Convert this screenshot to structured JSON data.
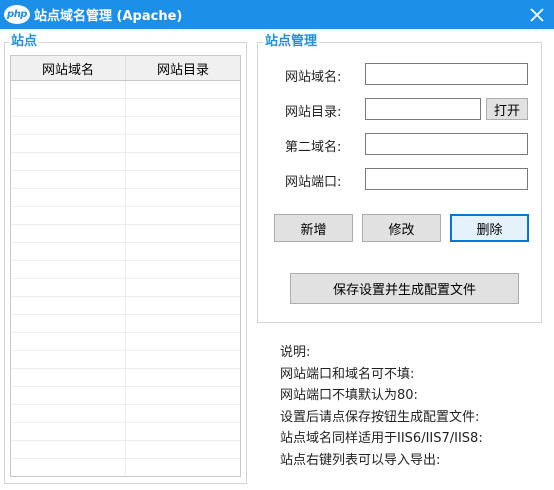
{
  "window": {
    "title": "站点域名管理 (Apache)",
    "app_icon_text": "php",
    "close_icon": "close-icon",
    "title_bar_color": "#1c8fe8"
  },
  "sites_group": {
    "title": "站点",
    "columns": [
      "网站域名",
      "网站目录"
    ],
    "rows": []
  },
  "manage_group": {
    "title": "站点管理",
    "domain_label": "网站域名:",
    "domain_value": "",
    "dir_label": "网站目录:",
    "dir_value": "",
    "open_button": "打开",
    "second_domain_label": "第二域名:",
    "second_domain_value": "",
    "port_label": "网站端口:",
    "port_value": "",
    "add_button": "新增",
    "edit_button": "修改",
    "delete_button": "删除",
    "save_button": "保存设置并生成配置文件"
  },
  "notes": {
    "title": "说明:",
    "lines": [
      "网站端口和域名可不填:",
      "网站端口不填默认为80:",
      "设置后请点保存按钮生成配置文件:",
      "站点域名同样适用于IIS6/IIS7/IIS8:",
      "站点右键列表可以导入导出:"
    ]
  }
}
